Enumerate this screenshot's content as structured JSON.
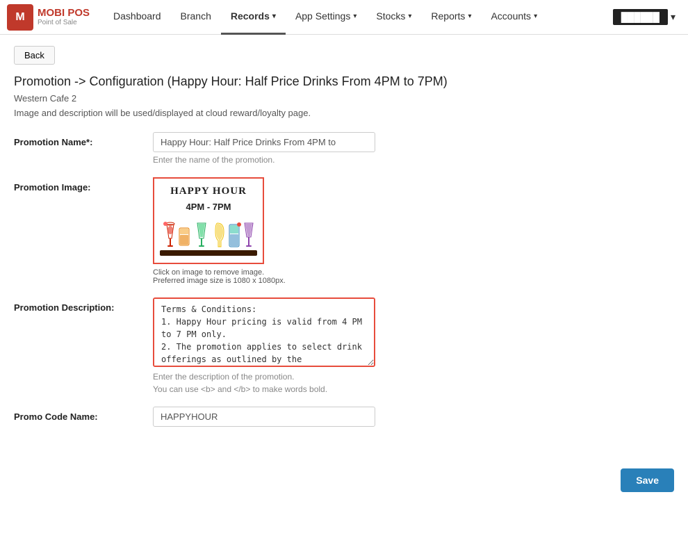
{
  "brand": {
    "logo_letter": "M",
    "name": "MOBI POS",
    "subtitle": "Point of Sale"
  },
  "nav": {
    "items": [
      {
        "id": "dashboard",
        "label": "Dashboard",
        "active": false,
        "has_caret": false
      },
      {
        "id": "branch",
        "label": "Branch",
        "active": false,
        "has_caret": false
      },
      {
        "id": "records",
        "label": "Records",
        "active": true,
        "has_caret": true
      },
      {
        "id": "app-settings",
        "label": "App Settings",
        "active": false,
        "has_caret": true
      },
      {
        "id": "stocks",
        "label": "Stocks",
        "active": false,
        "has_caret": true
      },
      {
        "id": "reports",
        "label": "Reports",
        "active": false,
        "has_caret": true
      },
      {
        "id": "accounts",
        "label": "Accounts",
        "active": false,
        "has_caret": true
      }
    ],
    "user": "██████"
  },
  "buttons": {
    "back": "Back",
    "save": "Save"
  },
  "breadcrumb": "Promotion -> Configuration (Happy Hour: Half Price Drinks From 4PM to 7PM)",
  "branch_name": "Western Cafe 2",
  "info_text": "Image and description will be used/displayed at cloud reward/loyalty page.",
  "form": {
    "promotion_name_label": "Promotion Name*:",
    "promotion_name_value": "Happy Hour: Half Price Drinks From 4PM to",
    "promotion_name_placeholder": "Enter the name of the promotion.",
    "promotion_name_hint": "Enter the name of the promotion.",
    "promotion_image_label": "Promotion Image:",
    "promotion_image_title": "HAPPY HOUR",
    "promotion_image_time": "4PM - 7PM",
    "promotion_image_hint1": "Click on image to remove image.",
    "promotion_image_hint2": "Preferred image size is 1080 x 1080px.",
    "promotion_description_label": "Promotion Description:",
    "promotion_description_value": "Terms & Conditions:\n1. Happy Hour pricing is valid from 4 PM to 7 PM only.\n2. The promotion applies to select drink offerings as outlined by the establishment.",
    "promotion_description_hint1": "Enter the description of the promotion.",
    "promotion_description_hint2": "You can use <b> and </b> to make words bold.",
    "promo_code_label": "Promo Code Name:",
    "promo_code_value": "HAPPYHOUR"
  }
}
